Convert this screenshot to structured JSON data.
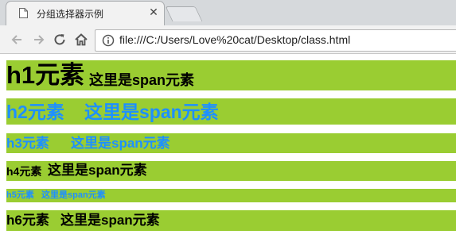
{
  "browser": {
    "tab_title": "分组选择器示例",
    "tab_close": "✕",
    "url": "file:///C:/Users/Love%20cat/Desktop/class.html"
  },
  "content": {
    "span_text": "这里是span元素",
    "rows": [
      {
        "heading": "h1元素",
        "span": "这里是span元素"
      },
      {
        "heading": "h2元素",
        "span": "这里是span元素"
      },
      {
        "heading": "h3元素",
        "span": "这里是span元素"
      },
      {
        "heading": "h4元素",
        "span": "这里是span元素"
      },
      {
        "heading": "h5元素",
        "span": "这里是span元素"
      },
      {
        "heading": "h6元素",
        "span": "这里是span元素"
      }
    ]
  },
  "colors": {
    "bar_bg": "#9acd32",
    "blue_text": "#1e90ff",
    "black_text": "#000000"
  }
}
